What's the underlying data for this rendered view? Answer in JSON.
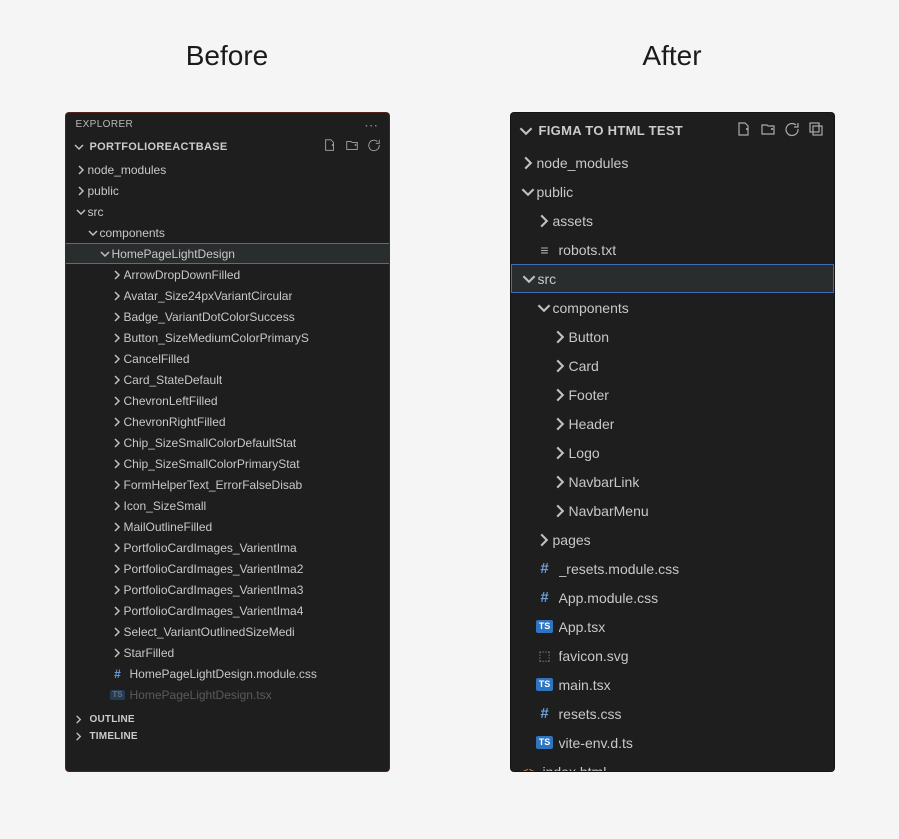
{
  "titles": {
    "before": "Before",
    "after": "After"
  },
  "before": {
    "explorer_label": "EXPLORER",
    "project_name": "PORTFOLIOREACTBASE",
    "tree": [
      {
        "depth": 0,
        "kind": "folder",
        "state": "closed",
        "label": "node_modules"
      },
      {
        "depth": 0,
        "kind": "folder",
        "state": "closed",
        "label": "public"
      },
      {
        "depth": 0,
        "kind": "folder",
        "state": "open",
        "label": "src"
      },
      {
        "depth": 1,
        "kind": "folder",
        "state": "open",
        "label": "components"
      },
      {
        "depth": 2,
        "kind": "folder",
        "state": "open",
        "label": "HomePageLightDesign",
        "selected": true
      },
      {
        "depth": 3,
        "kind": "folder",
        "state": "closed",
        "label": "ArrowDropDownFilled"
      },
      {
        "depth": 3,
        "kind": "folder",
        "state": "closed",
        "label": "Avatar_Size24pxVariantCircular"
      },
      {
        "depth": 3,
        "kind": "folder",
        "state": "closed",
        "label": "Badge_VariantDotColorSuccess"
      },
      {
        "depth": 3,
        "kind": "folder",
        "state": "closed",
        "label": "Button_SizeMediumColorPrimaryS"
      },
      {
        "depth": 3,
        "kind": "folder",
        "state": "closed",
        "label": "CancelFilled"
      },
      {
        "depth": 3,
        "kind": "folder",
        "state": "closed",
        "label": "Card_StateDefault"
      },
      {
        "depth": 3,
        "kind": "folder",
        "state": "closed",
        "label": "ChevronLeftFilled"
      },
      {
        "depth": 3,
        "kind": "folder",
        "state": "closed",
        "label": "ChevronRightFilled"
      },
      {
        "depth": 3,
        "kind": "folder",
        "state": "closed",
        "label": "Chip_SizeSmallColorDefaultStat"
      },
      {
        "depth": 3,
        "kind": "folder",
        "state": "closed",
        "label": "Chip_SizeSmallColorPrimaryStat"
      },
      {
        "depth": 3,
        "kind": "folder",
        "state": "closed",
        "label": "FormHelperText_ErrorFalseDisab"
      },
      {
        "depth": 3,
        "kind": "folder",
        "state": "closed",
        "label": "Icon_SizeSmall"
      },
      {
        "depth": 3,
        "kind": "folder",
        "state": "closed",
        "label": "MailOutlineFilled"
      },
      {
        "depth": 3,
        "kind": "folder",
        "state": "closed",
        "label": "PortfolioCardImages_VarientIma"
      },
      {
        "depth": 3,
        "kind": "folder",
        "state": "closed",
        "label": "PortfolioCardImages_VarientIma2"
      },
      {
        "depth": 3,
        "kind": "folder",
        "state": "closed",
        "label": "PortfolioCardImages_VarientIma3"
      },
      {
        "depth": 3,
        "kind": "folder",
        "state": "closed",
        "label": "PortfolioCardImages_VarientIma4"
      },
      {
        "depth": 3,
        "kind": "folder",
        "state": "closed",
        "label": "Select_VariantOutlinedSizeMedi"
      },
      {
        "depth": 3,
        "kind": "folder",
        "state": "closed",
        "label": "StarFilled"
      },
      {
        "depth": 3,
        "kind": "file",
        "icon": "hash",
        "label": "HomePageLightDesign.module.css"
      },
      {
        "depth": 3,
        "kind": "file",
        "icon": "ts",
        "label": "HomePageLightDesign.tsx",
        "dim": true
      }
    ],
    "footer": [
      "OUTLINE",
      "TIMELINE"
    ]
  },
  "after": {
    "project_name": "FIGMA TO HTML TEST",
    "tree": [
      {
        "depth": 0,
        "kind": "folder",
        "state": "closed",
        "label": "node_modules"
      },
      {
        "depth": 0,
        "kind": "folder",
        "state": "open",
        "label": "public"
      },
      {
        "depth": 1,
        "kind": "folder",
        "state": "closed",
        "label": "assets"
      },
      {
        "depth": 1,
        "kind": "file",
        "icon": "txt",
        "label": "robots.txt"
      },
      {
        "depth": 0,
        "kind": "folder",
        "state": "open",
        "label": "src",
        "selected": true
      },
      {
        "depth": 1,
        "kind": "folder",
        "state": "open",
        "label": "components"
      },
      {
        "depth": 2,
        "kind": "folder",
        "state": "closed",
        "label": "Button"
      },
      {
        "depth": 2,
        "kind": "folder",
        "state": "closed",
        "label": "Card"
      },
      {
        "depth": 2,
        "kind": "folder",
        "state": "closed",
        "label": "Footer"
      },
      {
        "depth": 2,
        "kind": "folder",
        "state": "closed",
        "label": "Header"
      },
      {
        "depth": 2,
        "kind": "folder",
        "state": "closed",
        "label": "Logo"
      },
      {
        "depth": 2,
        "kind": "folder",
        "state": "closed",
        "label": "NavbarLink"
      },
      {
        "depth": 2,
        "kind": "folder",
        "state": "closed",
        "label": "NavbarMenu"
      },
      {
        "depth": 1,
        "kind": "folder",
        "state": "closed",
        "label": "pages"
      },
      {
        "depth": 1,
        "kind": "file",
        "icon": "hash",
        "label": "_resets.module.css"
      },
      {
        "depth": 1,
        "kind": "file",
        "icon": "hash",
        "label": "App.module.css"
      },
      {
        "depth": 1,
        "kind": "file",
        "icon": "ts",
        "label": "App.tsx"
      },
      {
        "depth": 1,
        "kind": "file",
        "icon": "svg",
        "label": "favicon.svg"
      },
      {
        "depth": 1,
        "kind": "file",
        "icon": "ts",
        "label": "main.tsx"
      },
      {
        "depth": 1,
        "kind": "file",
        "icon": "hash",
        "label": "resets.css"
      },
      {
        "depth": 1,
        "kind": "file",
        "icon": "ts",
        "label": "vite-env.d.ts"
      },
      {
        "depth": 0,
        "kind": "file",
        "icon": "code",
        "label": "index.html"
      }
    ]
  },
  "toolbar_icons": [
    "new-file-icon",
    "new-folder-icon",
    "refresh-icon",
    "collapse-all-icon"
  ]
}
